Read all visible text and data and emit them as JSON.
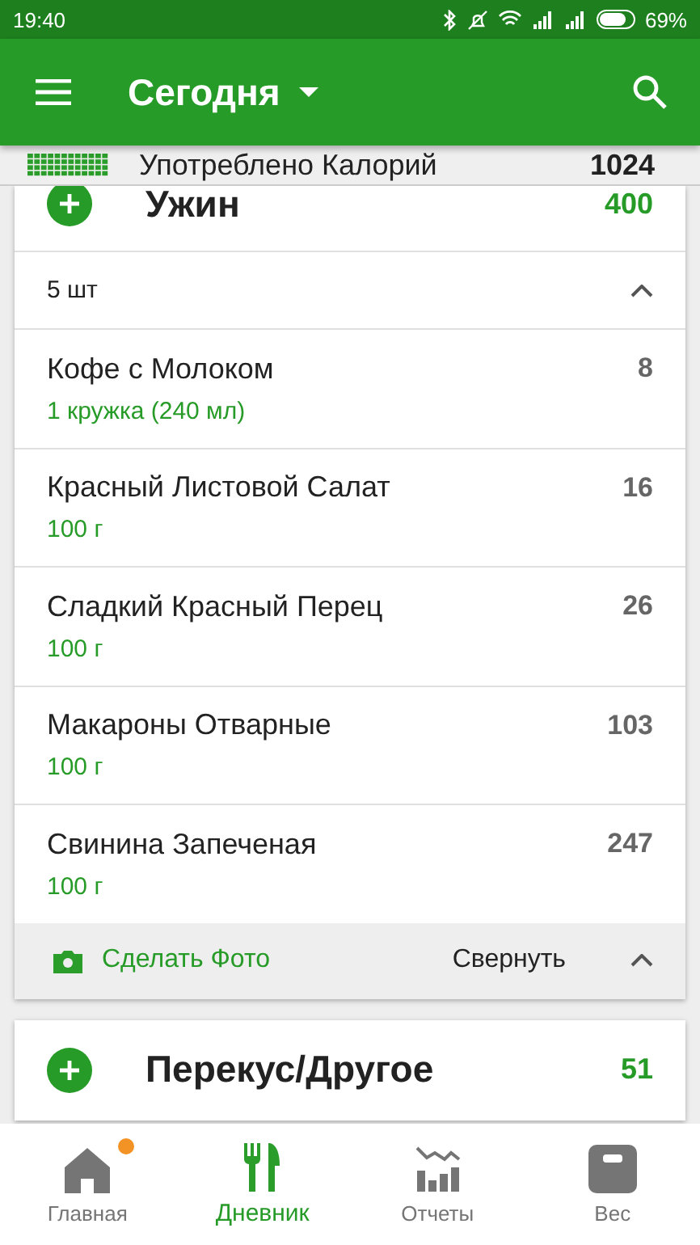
{
  "status_bar": {
    "time": "19:40",
    "battery": "69%"
  },
  "app_bar": {
    "title": "Сегодня"
  },
  "summary": {
    "label": "Употреблено Калорий",
    "value": "1024"
  },
  "meals": [
    {
      "name": "Ужин",
      "calories": "400",
      "count": "5 шт",
      "expanded": true,
      "items": [
        {
          "name": "Кофе с Молоком",
          "amount": "1  кружка (240 мл)",
          "calories": "8"
        },
        {
          "name": "Красный Листовой Салат",
          "amount": "100  г",
          "calories": "16"
        },
        {
          "name": "Сладкий Красный Перец",
          "amount": "100  г",
          "calories": "26"
        },
        {
          "name": "Макароны Отварные",
          "amount": "100  г",
          "calories": "103"
        },
        {
          "name": "Свинина Запеченая",
          "amount": "100  г",
          "calories": "247"
        }
      ],
      "photo_label": "Сделать Фото",
      "collapse_label": "Свернуть"
    },
    {
      "name": "Перекус/Другое",
      "calories": "51"
    }
  ],
  "bottom_nav": [
    {
      "label": "Главная",
      "kind": "home",
      "selected": false,
      "badge": true
    },
    {
      "label": "Дневник",
      "kind": "diary",
      "selected": true,
      "badge": false
    },
    {
      "label": "Отчеты",
      "kind": "reports",
      "selected": false,
      "badge": false
    },
    {
      "label": "Вес",
      "kind": "weight",
      "selected": false,
      "badge": false
    }
  ]
}
